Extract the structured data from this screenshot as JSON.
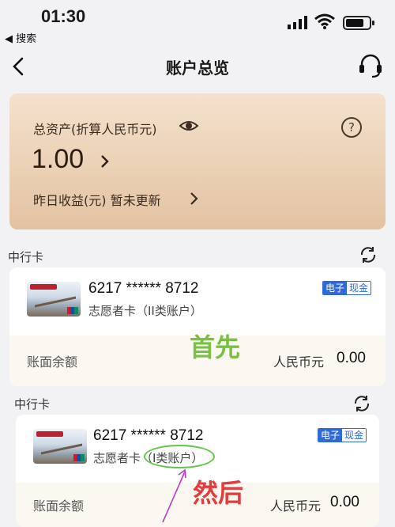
{
  "status": {
    "time": "01:30",
    "back_app": "◀ 搜索"
  },
  "header": {
    "title": "账户总览"
  },
  "assets": {
    "label": "总资产(折算人民币元)",
    "value": "1.00",
    "help": "?",
    "yield_label": "昨日收益(元)  暂未更新"
  },
  "sections": [
    {
      "title": "中行卡",
      "card": {
        "number": "6217 ****** 8712",
        "name": "志愿者卡（II类账户）",
        "tags": [
          "电子",
          "现金"
        ],
        "balance_label": "账面余额",
        "currency": "人民币元",
        "amount": "0.00"
      }
    },
    {
      "title": "中行卡",
      "card": {
        "number": "6217 ****** 8712",
        "name": "志愿者卡（I类账户）",
        "tags": [
          "电子",
          "现金"
        ],
        "balance_label": "账面余额",
        "currency": "人民币元",
        "amount": "0.00"
      }
    }
  ],
  "annotations": {
    "first": "首先",
    "then": "然后"
  },
  "colors": {
    "accent_blue": "#2f6ad8",
    "asset_card": "#eacfb3",
    "note_green": "#7ac143",
    "note_red": "#e53b3b"
  }
}
